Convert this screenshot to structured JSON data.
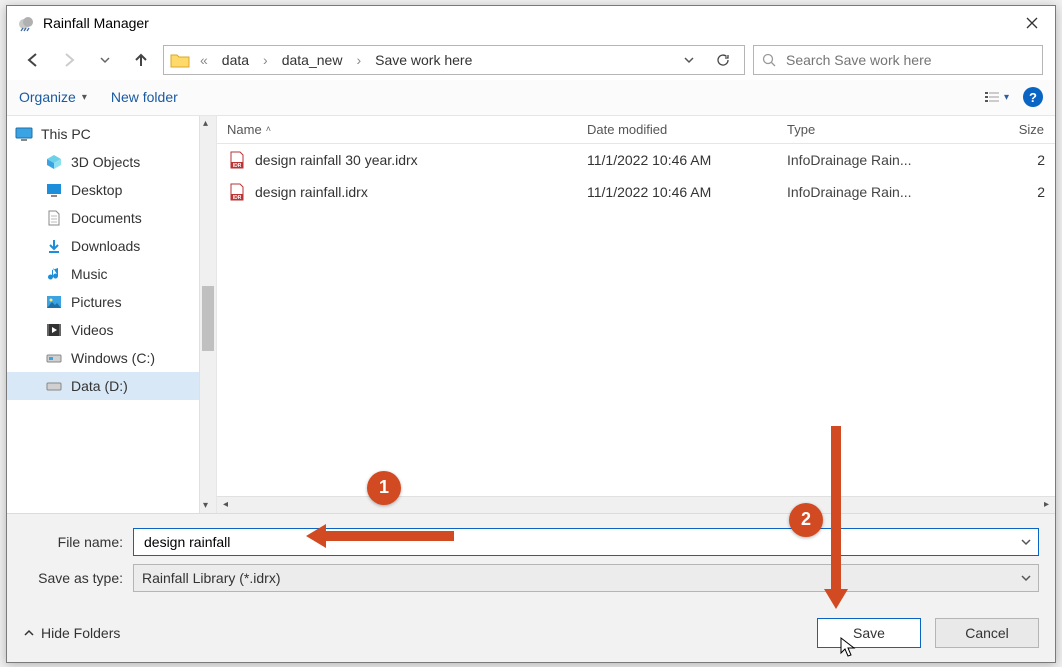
{
  "titlebar": {
    "title": "Rainfall Manager"
  },
  "nav": {
    "back_enabled": true,
    "forward_enabled": false,
    "root_label": "«",
    "crumbs": [
      "data",
      "data_new",
      "Save work here"
    ],
    "refresh_label": "Refresh"
  },
  "search": {
    "placeholder": "Search Save work here"
  },
  "toolbar": {
    "organize": "Organize",
    "new_folder": "New folder",
    "help": "?"
  },
  "tree": {
    "root": {
      "label": "This PC"
    },
    "items": [
      {
        "label": "3D Objects"
      },
      {
        "label": "Desktop"
      },
      {
        "label": "Documents"
      },
      {
        "label": "Downloads"
      },
      {
        "label": "Music"
      },
      {
        "label": "Pictures"
      },
      {
        "label": "Videos"
      },
      {
        "label": "Windows (C:)"
      },
      {
        "label": "Data (D:)",
        "selected": true
      }
    ]
  },
  "columns": {
    "name": "Name",
    "date": "Date modified",
    "type": "Type",
    "size": "Size"
  },
  "files": [
    {
      "name": "design rainfall 30 year.idrx",
      "date": "11/1/2022 10:46 AM",
      "type": "InfoDrainage Rain...",
      "size": "2"
    },
    {
      "name": "design rainfall.idrx",
      "date": "11/1/2022 10:46 AM",
      "type": "InfoDrainage Rain...",
      "size": "2"
    }
  ],
  "form": {
    "filename_label": "File name:",
    "filename_value": "design rainfall",
    "filetype_label": "Save as type:",
    "filetype_value": "Rainfall Library (*.idrx)"
  },
  "actions": {
    "hide_folders": "Hide Folders",
    "save": "Save",
    "cancel": "Cancel"
  },
  "annotations": {
    "badge1": "1",
    "badge2": "2"
  }
}
